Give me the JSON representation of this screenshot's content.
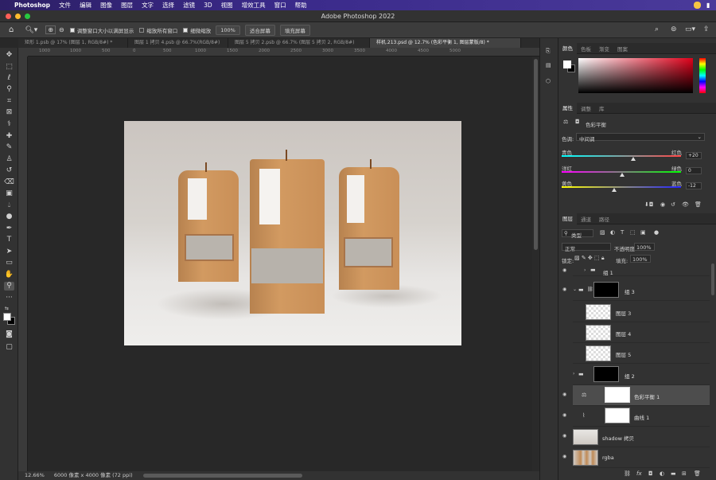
{
  "menubar": {
    "apple": "",
    "app": "Photoshop",
    "items": [
      "文件",
      "编辑",
      "图像",
      "图层",
      "文字",
      "选择",
      "滤镜",
      "3D",
      "视图",
      "增效工具",
      "窗口",
      "帮助"
    ]
  },
  "titlebar": {
    "title": "Adobe Photoshop 2022"
  },
  "options": {
    "fit_window": "调整窗口大小以满屏显示",
    "zoom_all": "缩放所有窗口",
    "scrubby": "细微缩放",
    "zoom_value": "100%",
    "fit_screen": "适合屏幕",
    "fill_screen": "填充屏幕"
  },
  "tabs": [
    "矩形 1.psb @ 17% (图层 1, RGB/8#) *",
    "图层 1 拷贝 4.psb @ 66.7%(RGB/8#)",
    "图层 5 拷贝 2.psb @ 66.7% (图层 5 拷贝 2, RGB/8#)",
    "样机.213.psd @ 12.7% (色彩平衡 1, 图层蒙版/8) *"
  ],
  "ruler": [
    "1000",
    "1000",
    "500",
    "0",
    "500",
    "1000",
    "1500",
    "2000",
    "2500",
    "3000",
    "3500",
    "4000",
    "4500",
    "5000"
  ],
  "status": {
    "zoom": "12.66%",
    "doc": "6000 像素 x 4000 像素 (72 ppi)"
  },
  "color_panel": {
    "tabs": [
      "颜色",
      "色板",
      "渐变",
      "图案"
    ]
  },
  "properties": {
    "tabs": [
      "属性",
      "调整",
      "库"
    ],
    "adjustment": "色彩平衡",
    "tone_label": "色调:",
    "tone_value": "中间调",
    "sliders": [
      {
        "left": "青色",
        "right": "红色",
        "value": "+20",
        "pos": 0.59
      },
      {
        "left": "洋红",
        "right": "绿色",
        "value": "0",
        "pos": 0.5
      },
      {
        "left": "黄色",
        "right": "蓝色",
        "value": "-12",
        "pos": 0.44
      }
    ]
  },
  "layers_panel": {
    "tabs": [
      "图层",
      "通道",
      "路径"
    ],
    "filter": "类型",
    "blend": "正常",
    "opacity_label": "不透明度:",
    "opacity": "100%",
    "lock_label": "锁定:",
    "fill_label": "填充:",
    "fill": "100%",
    "layers": [
      {
        "name": "组 1",
        "type": "group",
        "visible": true
      },
      {
        "name": "组 3",
        "type": "group-open",
        "visible": true
      },
      {
        "name": "图层 3",
        "type": "smart",
        "visible": false
      },
      {
        "name": "图层 4",
        "type": "smart",
        "visible": false
      },
      {
        "name": "图层 5",
        "type": "smart",
        "visible": false
      },
      {
        "name": "组 2",
        "type": "group",
        "visible": false
      },
      {
        "name": "色彩平衡 1",
        "type": "adjust",
        "visible": true,
        "selected": true
      },
      {
        "name": "曲线 1",
        "type": "adjust",
        "visible": true
      },
      {
        "name": "shadow 拷贝",
        "type": "image",
        "visible": true
      },
      {
        "name": "rgba",
        "type": "image",
        "visible": true
      }
    ]
  }
}
